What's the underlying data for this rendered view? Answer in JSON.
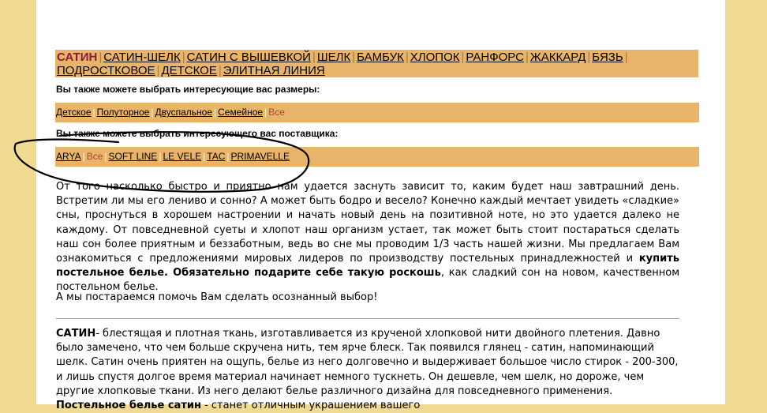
{
  "categories": {
    "current": "САТИН",
    "items": [
      "САТИН-ШЕЛК",
      "САТИН С ВЫШЕВКОЙ",
      "ШЕЛК",
      "БАМБУК",
      "ХЛОПОК",
      "РАНФОРС",
      "ЖАККАРД",
      "БЯЗЬ",
      "ПОДРОСТКОВОЕ",
      "ДЕТСКОЕ",
      "ЭЛИТНАЯ ЛИНИЯ"
    ]
  },
  "sizes": {
    "label": "Вы также можете выбрать интересующие вас размеры:",
    "items": [
      "Детское",
      "Полуторное",
      "Двуспальное",
      "Семейное"
    ],
    "current": "Все"
  },
  "suppliers": {
    "label": "Вы также можете выбрать интересующего вас поставщика:",
    "first": "ARYA",
    "current": "Все",
    "items": [
      "SOFT LINE",
      "LE VELE",
      "TAC",
      "PRIMAVELLE"
    ]
  },
  "intro": {
    "p1_a": "От того насколько быстро и приятно нам удается заснуть зависит то, каким будет наш завтрашний день.  Встретим ли мы его лениво и сонно? А может быть бодро и весело? Конечно каждый мечтает увидеть «сладкие» сны, проснуться в хорошем настроении  и начать новый день на позитивной ноте, но это удается далеко не каждому.  От повседневной суеты и хлопот наш организм устает, так может быть стоит постараться сделать наш сон более приятным и беззаботным, ведь во сне мы проводим 1/3 часть нашей жизни. Мы предлагаем Вам ознакомиться с предложениями мировых лидеров по производству постельных принадлежностей и ",
    "p1_b": "купить постельное белье",
    "p1_c": ". Обязательно подарите себе такую роскошь",
    "p1_d": ", как сладкий сон на новом, качественном постельном белье.",
    "p2": "А мы постараемся помочь Вам сделать осознанный выбор!"
  },
  "satin": {
    "term": "САТИН",
    "text_a": "- блестящая и плотная ткань, изготавливается из крученой хлопковой нити двойного плетения. Давно было замечено, что чем больше скручена нить, тем ярче блеск. Так появился глянец - сатин, напоминающий шелк. Сатин очень приятен на ощупь, белье из него долговечно и выдерживает большое число стирок - 200-300, и лишь спустя долгое время материал начинает немного тускнеть. Он дешевле, чем шелк, но дороже, чем другие хлопковые ткани. Из него делают белье различного дизайна для повседневного применения. ",
    "bold": "Постельное белье сатин",
    "text_b": " - станет отличным украшением вашего"
  },
  "colors": {
    "background": "#f1db93",
    "bar": "#e8b46a",
    "current": "#8b1a3c"
  }
}
